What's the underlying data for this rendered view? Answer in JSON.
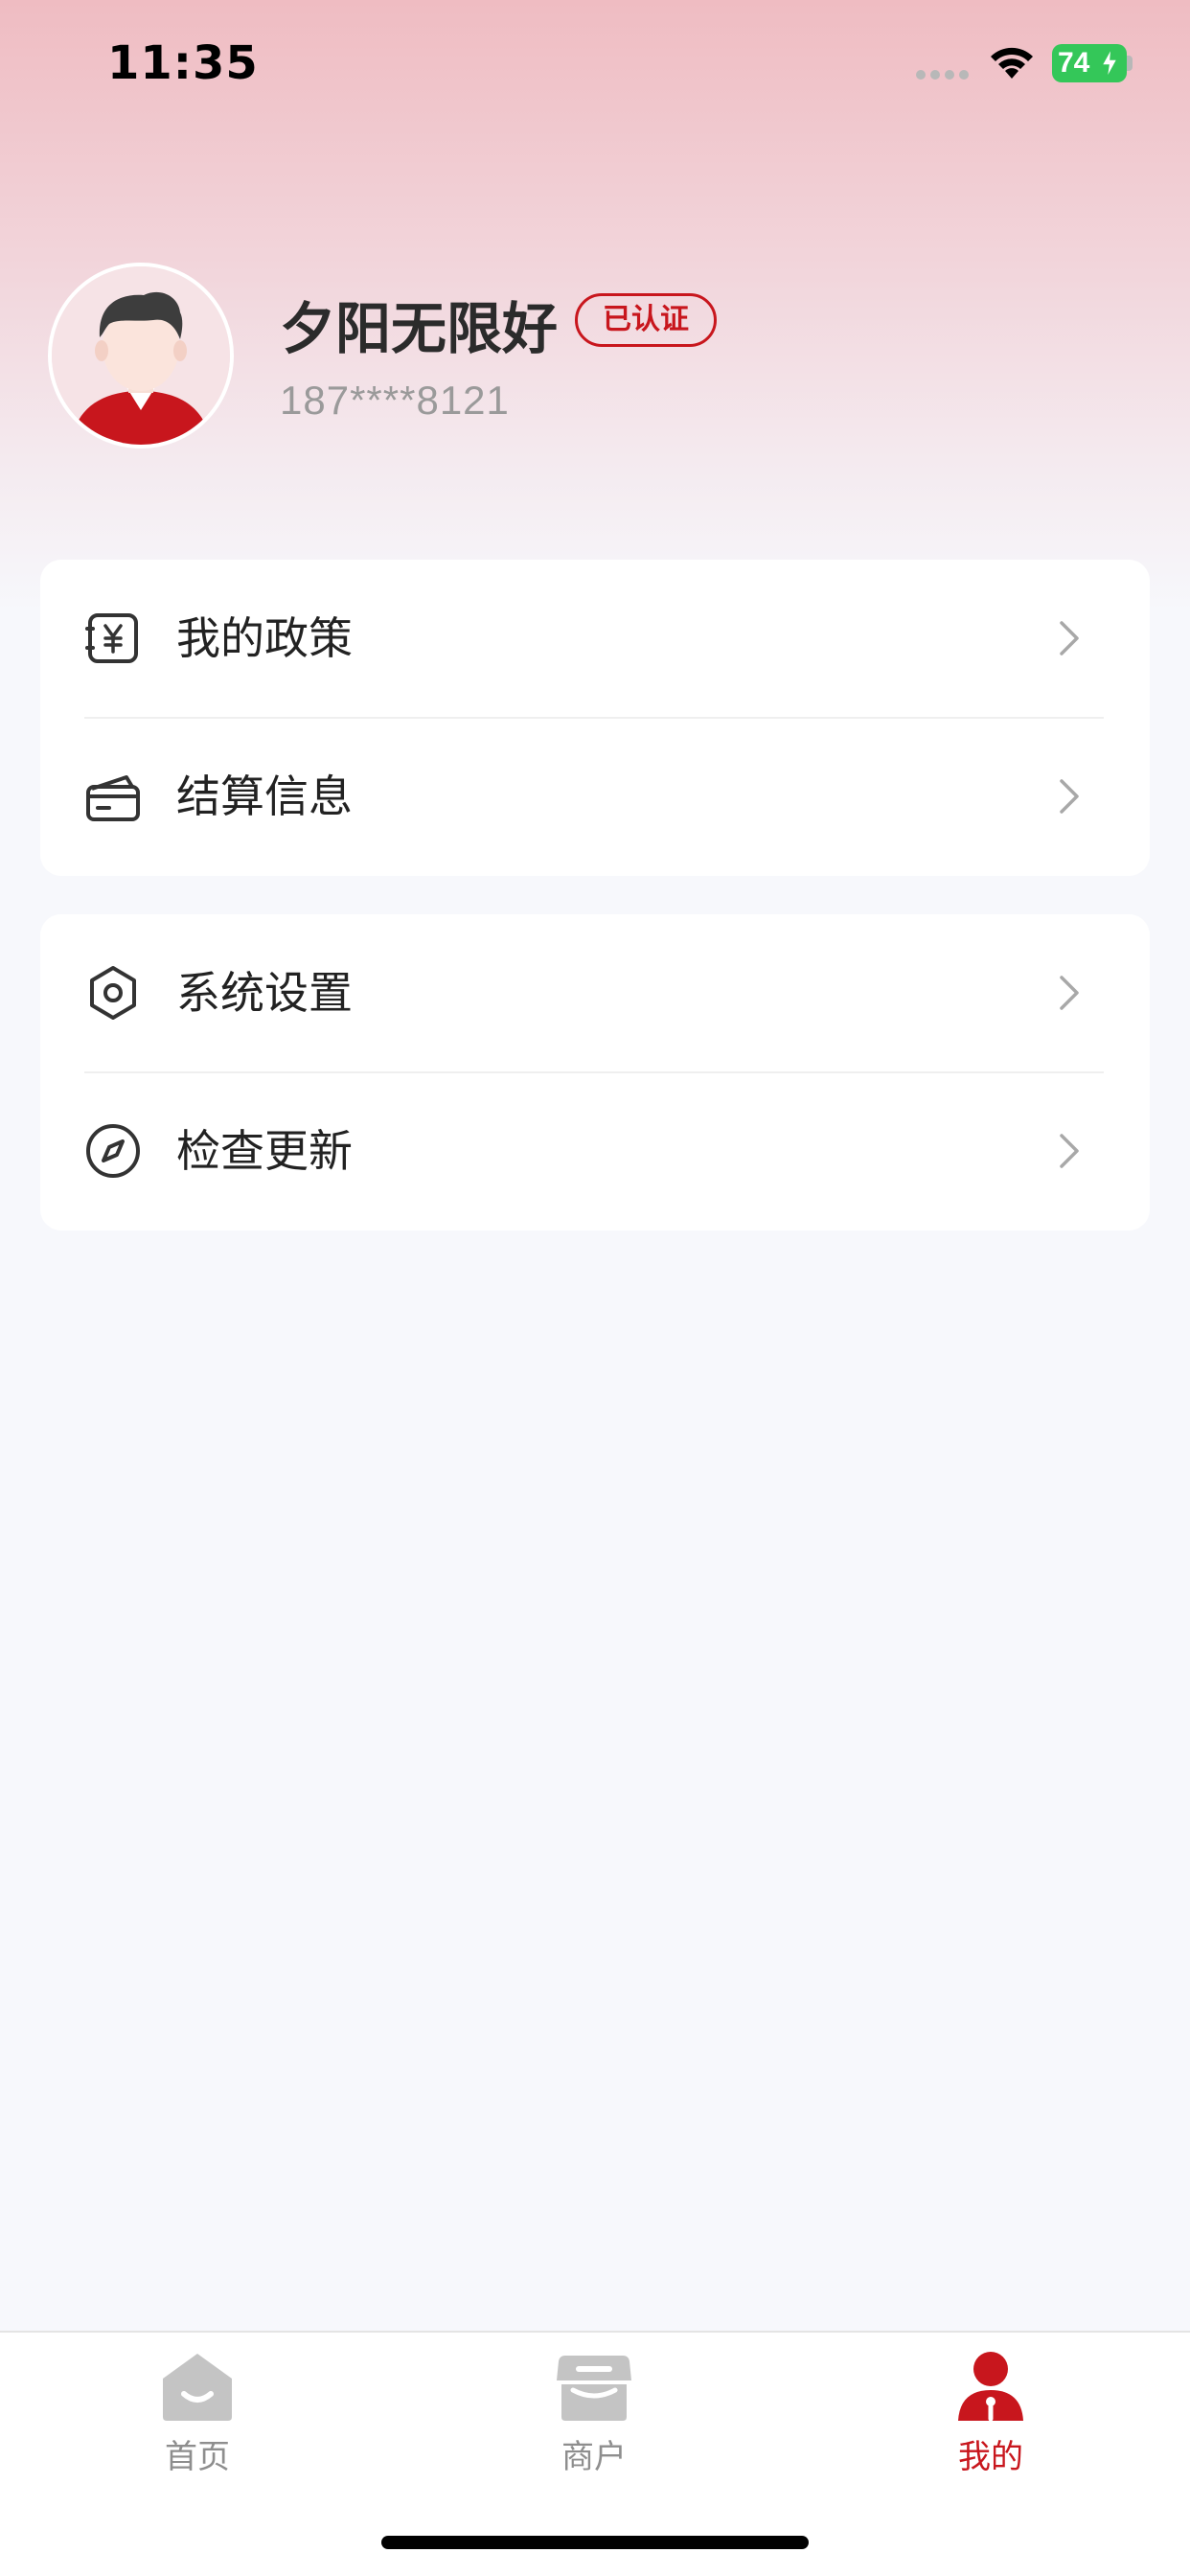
{
  "status_bar": {
    "time": "11:35",
    "battery": "74"
  },
  "profile": {
    "name": "夕阳无限好",
    "verified_label": "已认证",
    "phone": "187****8121"
  },
  "menu_groups": [
    {
      "items": [
        {
          "label": "我的政策",
          "icon": "yuan-document-icon"
        },
        {
          "label": "结算信息",
          "icon": "card-icon"
        }
      ]
    },
    {
      "items": [
        {
          "label": "系统设置",
          "icon": "settings-hexagon-icon"
        },
        {
          "label": "检查更新",
          "icon": "compass-icon"
        }
      ]
    }
  ],
  "tab_bar": {
    "items": [
      {
        "label": "首页",
        "icon": "home-icon",
        "active": false
      },
      {
        "label": "商户",
        "icon": "store-icon",
        "active": false
      },
      {
        "label": "我的",
        "icon": "user-icon",
        "active": true
      }
    ]
  },
  "colors": {
    "accent": "#c8161d",
    "inactive": "#8e8e8e",
    "background": "#f7f8fc",
    "battery": "#34c759"
  }
}
